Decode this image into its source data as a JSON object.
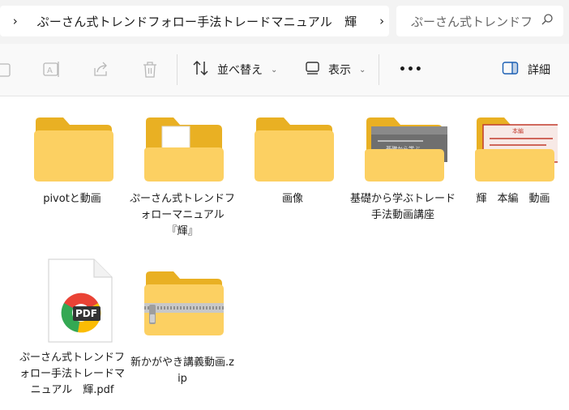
{
  "address": {
    "path": "ぷーさん式トレンドフォロー手法トレードマニュアル　輝",
    "search_placeholder": "ぷーさん式トレンドフ"
  },
  "toolbar": {
    "sort_label": "並べ替え",
    "view_label": "表示",
    "more_label": "•••",
    "details_label": "詳細"
  },
  "items": [
    {
      "label": "pivotと動画",
      "icon": "folder-icon"
    },
    {
      "label": "ぷーさん式トレンドフォローマニュアル『輝』",
      "icon": "folder-icon"
    },
    {
      "label": "画像",
      "icon": "folder-icon"
    },
    {
      "label": "基礎から学ぶトレード手法動画講座",
      "icon": "folder-icon"
    },
    {
      "label": "輝　本編　動画",
      "icon": "folder-icon"
    },
    {
      "label": "ぷーさん式トレンドフォロー手法トレードマニュアル　輝.pdf",
      "icon": "pdf-file-icon"
    },
    {
      "label": "新かがやき講義動画.zip",
      "icon": "zip-folder-icon"
    }
  ],
  "thumbnails": {
    "video_course_title": "基礎から学ぶ",
    "main_video_title": "本編"
  },
  "colors": {
    "folder_back": "#e9b023",
    "folder_front": "#fcd062",
    "toolbar_bg": "#f9f9f9",
    "address_bg": "#f3f3f3"
  }
}
